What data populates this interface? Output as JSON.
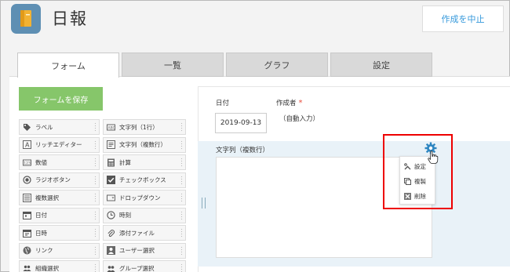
{
  "app": {
    "title": "日報"
  },
  "header": {
    "cancel_label": "作成を中止"
  },
  "tabs": [
    {
      "label": "フォーム",
      "active": true
    },
    {
      "label": "一覧",
      "active": false
    },
    {
      "label": "グラフ",
      "active": false
    },
    {
      "label": "設定",
      "active": false
    }
  ],
  "palette": {
    "save_label": "フォームを保存",
    "items": [
      {
        "label": "ラベル",
        "icon": "tag-icon"
      },
      {
        "label": "文字列（1行）",
        "icon": "text-single-icon"
      },
      {
        "label": "リッチエディター",
        "icon": "rich-editor-icon"
      },
      {
        "label": "文字列（複数行）",
        "icon": "text-multi-icon"
      },
      {
        "label": "数値",
        "icon": "number-icon"
      },
      {
        "label": "計算",
        "icon": "calculator-icon"
      },
      {
        "label": "ラジオボタン",
        "icon": "radio-icon"
      },
      {
        "label": "チェックボックス",
        "icon": "checkbox-icon"
      },
      {
        "label": "複数選択",
        "icon": "multi-select-icon"
      },
      {
        "label": "ドロップダウン",
        "icon": "dropdown-icon"
      },
      {
        "label": "日付",
        "icon": "calendar-icon"
      },
      {
        "label": "時刻",
        "icon": "clock-icon"
      },
      {
        "label": "日時",
        "icon": "datetime-icon"
      },
      {
        "label": "添付ファイル",
        "icon": "paperclip-icon"
      },
      {
        "label": "リンク",
        "icon": "globe-icon"
      },
      {
        "label": "ユーザー選択",
        "icon": "user-icon"
      },
      {
        "label": "組織選択",
        "icon": "org-icon"
      },
      {
        "label": "グループ選択",
        "icon": "group-icon"
      }
    ]
  },
  "form": {
    "date_label": "日付",
    "date_value": "2019-09-13",
    "author_label": "作成者",
    "required_mark": "*",
    "author_value": "（自動入力）",
    "multiline_label": "文字列（複数行）"
  },
  "context_menu": {
    "items": [
      {
        "label": "設定",
        "icon": "settings-tools-icon"
      },
      {
        "label": "複製",
        "icon": "copy-icon"
      },
      {
        "label": "削除",
        "icon": "delete-icon"
      }
    ]
  },
  "colors": {
    "accent": "#3498db",
    "save_green": "#86c66a",
    "highlight_red": "#e00000",
    "field_bg": "#e9f2f8"
  }
}
